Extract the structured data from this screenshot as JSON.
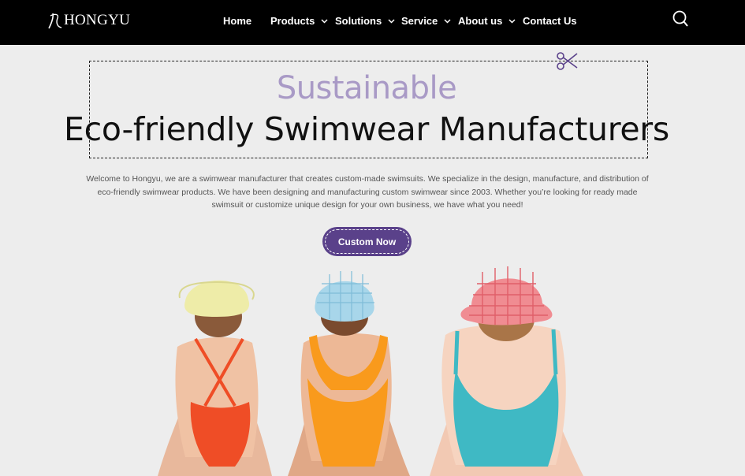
{
  "header": {
    "brand": "HONGYU",
    "nav": [
      {
        "label": "Home",
        "has_dropdown": false
      },
      {
        "label": "Products",
        "has_dropdown": true
      },
      {
        "label": "Solutions",
        "has_dropdown": true
      },
      {
        "label": "Service",
        "has_dropdown": true
      },
      {
        "label": "About us",
        "has_dropdown": true
      },
      {
        "label": "Contact Us",
        "has_dropdown": false
      }
    ],
    "search_icon": "search-icon"
  },
  "hero": {
    "kicker": "Sustainable",
    "title": "Eco-friendly Swimwear Manufacturers",
    "description": "Welcome to Hongyu, we are a swimwear manufacturer that creates custom-made swimsuits. We specialize in the design, manufacture, and distribution of eco-friendly swimwear products. We have been designing and manufacturing custom swimwear since 2003. Whether you’re looking for ready made swimsuit or customize unique design for your own business, we have what you need!",
    "cta_label": "Custom Now",
    "decor_icon": "scissors-icon"
  },
  "colors": {
    "header_bg": "#000000",
    "page_bg": "#ededed",
    "accent": "#5a418a",
    "kicker": "#a99ac6"
  }
}
